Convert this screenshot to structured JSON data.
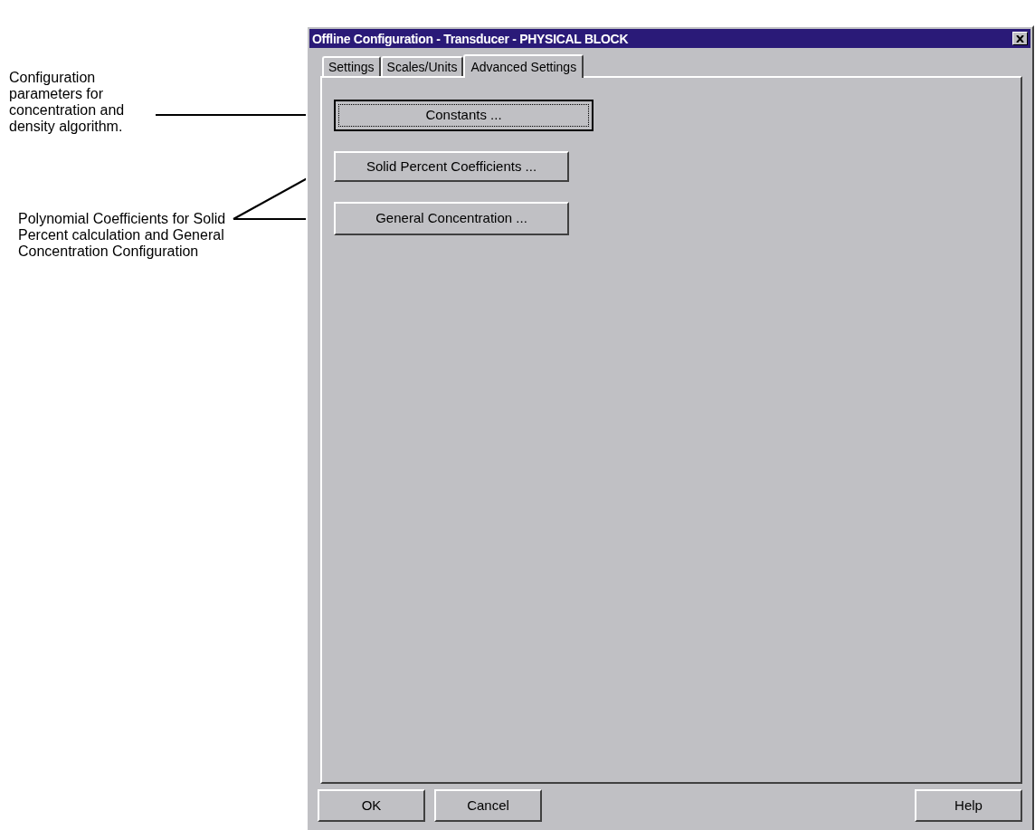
{
  "annotations": [
    {
      "text": "Configuration parameters for concentration and density algorithm."
    },
    {
      "text": "Polynomial Coefficients for Solid Percent calculation and General Concentration Configuration"
    }
  ],
  "window": {
    "title": "Offline Configuration - Transducer - PHYSICAL BLOCK"
  },
  "tabs": [
    {
      "label": "Settings",
      "selected": false
    },
    {
      "label": "Scales/Units",
      "selected": false
    },
    {
      "label": "Advanced Settings",
      "selected": true
    }
  ],
  "panel_buttons": [
    {
      "label": "Constants ...",
      "focused": true
    },
    {
      "label": "Solid Percent Coefficients ...",
      "focused": false
    },
    {
      "label": "General Concentration ...",
      "focused": false
    }
  ],
  "footer_buttons": [
    {
      "label": "OK"
    },
    {
      "label": "Cancel"
    },
    {
      "label": "Help"
    }
  ]
}
